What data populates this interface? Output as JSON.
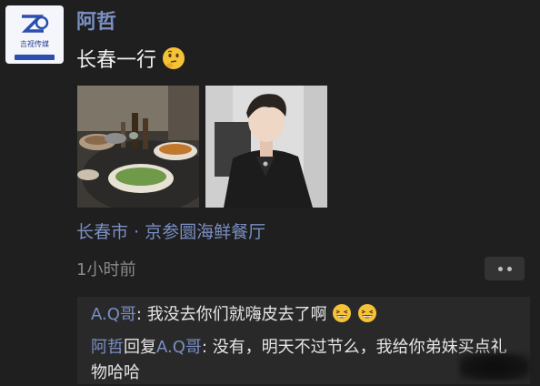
{
  "post": {
    "avatar": {
      "logo_text": "吉视传媒",
      "icon": "tv-station-logo"
    },
    "username": "阿哲",
    "text": "长春一行",
    "text_emoji": "thinking-face-icon",
    "photos": [
      {
        "alt": "food-table-photo"
      },
      {
        "alt": "selfie-photo"
      }
    ],
    "location": "长春市 · 京参圜海鲜餐厅",
    "timestamp": "1小时前",
    "more_icon": "more-dots-icon"
  },
  "comments": [
    {
      "author": "A.Q哥",
      "separator": ": ",
      "text": "我没去你们就嗨皮去了啊",
      "emoji": "grinning-sweat-icon"
    },
    {
      "author": "阿哲",
      "reply_word": "回复",
      "reply_to": "A.Q哥",
      "separator": ": ",
      "text": "没有，明天不过节么，我给你弟妹买点礼物哈哈"
    }
  ],
  "colors": {
    "background": "#1f1f1f",
    "name_color": "#7a8fc4",
    "comment_bg": "#292929"
  }
}
